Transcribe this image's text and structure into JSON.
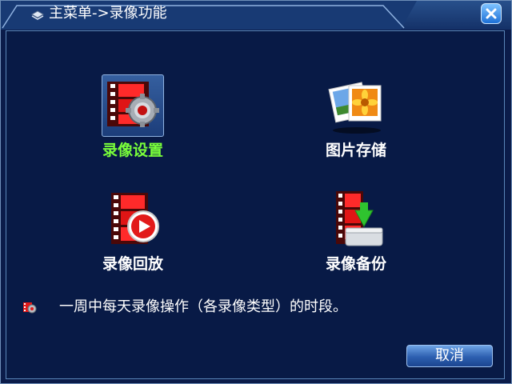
{
  "window": {
    "title": "主菜单->录像功能"
  },
  "menu": {
    "items": [
      {
        "label": "录像设置",
        "icon": "record-settings-icon",
        "selected": true
      },
      {
        "label": "图片存储",
        "icon": "photo-storage-icon",
        "selected": false
      },
      {
        "label": "录像回放",
        "icon": "playback-icon",
        "selected": false
      },
      {
        "label": "录像备份",
        "icon": "backup-icon",
        "selected": false
      }
    ]
  },
  "hint": {
    "text": "一周中每天录像操作（各录像类型）的时段。"
  },
  "buttons": {
    "cancel": "取消"
  },
  "colors": {
    "background": "#0b1c4a",
    "titlebar": "#28508c",
    "active_label": "#79ff3a",
    "label": "#ffffff"
  }
}
